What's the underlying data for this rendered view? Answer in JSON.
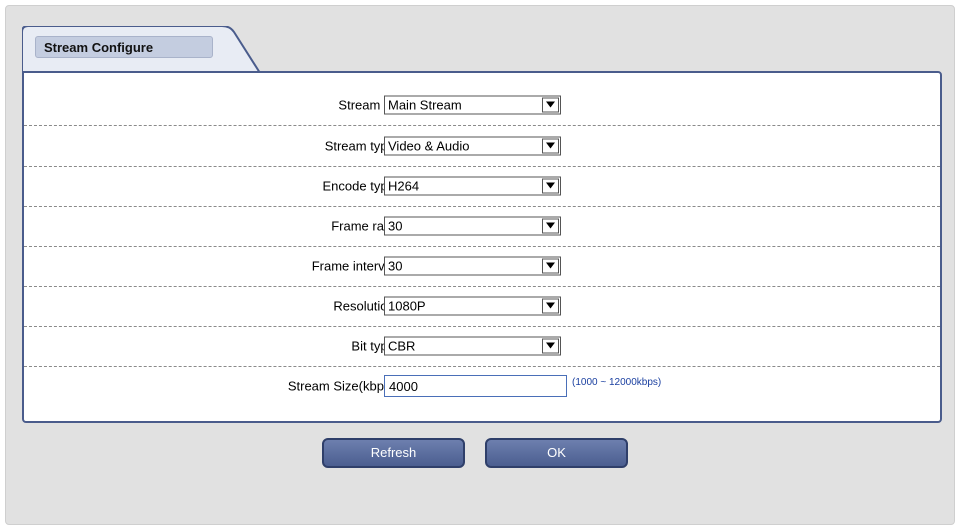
{
  "tab": {
    "title": "Stream Configure"
  },
  "fields": [
    {
      "label": "Stream Id :",
      "value": "Main Stream"
    },
    {
      "label": "Stream type :",
      "value": "Video & Audio"
    },
    {
      "label": "Encode type :",
      "value": "H264"
    },
    {
      "label": "Frame rate :",
      "value": "30"
    },
    {
      "label": "Frame interval :",
      "value": "30"
    },
    {
      "label": "Resolution :",
      "value": "1080P"
    },
    {
      "label": "Bit type :",
      "value": "CBR"
    }
  ],
  "stream_size": {
    "label": "Stream Size(kbps) :",
    "value": "4000",
    "hint": "(1000 ~ 12000kbps)"
  },
  "buttons": {
    "refresh": "Refresh",
    "ok": "OK"
  },
  "colors": {
    "panel_border": "#4a5c8c",
    "button_bg": "#5a6c9c",
    "hint_text": "#1a3fa0"
  }
}
